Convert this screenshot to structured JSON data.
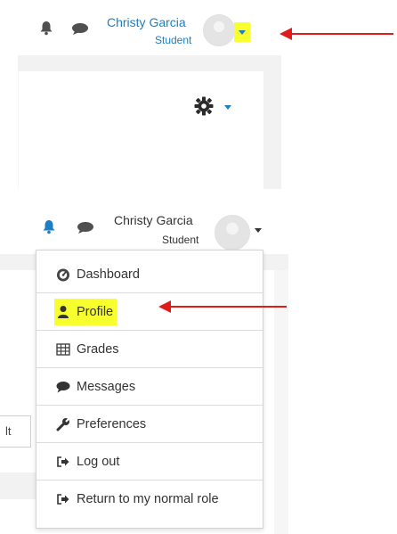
{
  "user": {
    "name": "Christy Garcia",
    "role": "Student"
  },
  "menu": {
    "items": [
      {
        "label": "Dashboard",
        "icon": "dashboard-icon"
      },
      {
        "label": "Profile",
        "icon": "user-icon"
      },
      {
        "label": "Grades",
        "icon": "table-icon"
      },
      {
        "label": "Messages",
        "icon": "message-icon"
      },
      {
        "label": "Preferences",
        "icon": "wrench-icon"
      },
      {
        "label": "Log out",
        "icon": "sign-out-icon"
      },
      {
        "label": "Return to my normal role",
        "icon": "sign-out-icon"
      }
    ]
  },
  "side_button_label": "lt",
  "colors": {
    "link": "#1b7fc4",
    "highlight": "#f7ff2c",
    "annotation_arrow": "#e21a1a",
    "icon_gray": "#555555"
  }
}
